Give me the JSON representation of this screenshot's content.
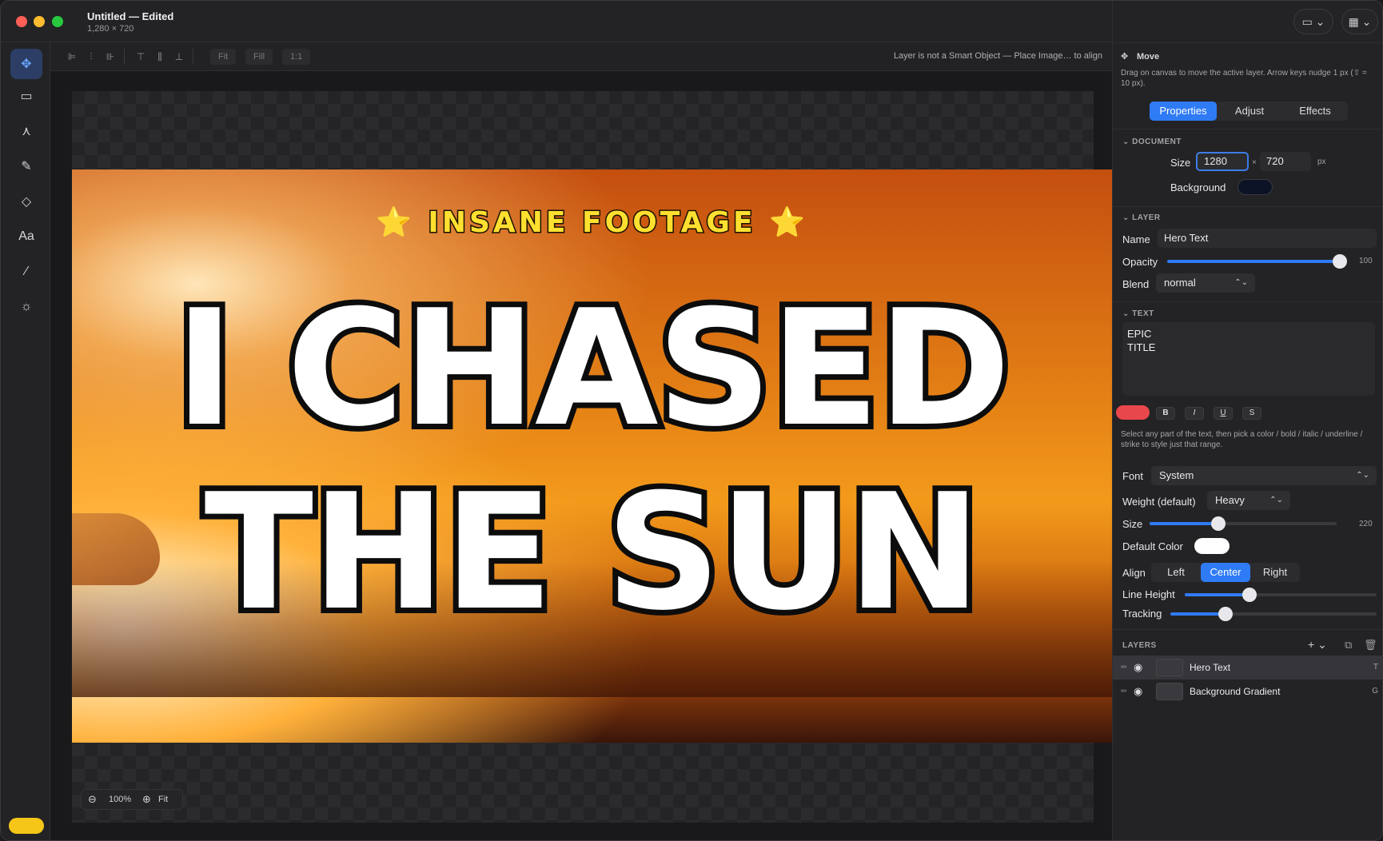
{
  "titlebar": {
    "title": "Untitled — Edited",
    "subtitle": "1,280 × 720"
  },
  "tools": [
    {
      "name": "move-tool",
      "icon": "move-icon",
      "glyph": "✥",
      "active": true
    },
    {
      "name": "marquee-tool",
      "icon": "marquee-icon",
      "glyph": "▭"
    },
    {
      "name": "pen-tool",
      "icon": "pen-icon",
      "glyph": "⋏"
    },
    {
      "name": "brush-tool",
      "icon": "brush-icon",
      "glyph": "✎"
    },
    {
      "name": "eraser-tool",
      "icon": "eraser-icon",
      "glyph": "◇"
    },
    {
      "name": "text-tool",
      "icon": "text-icon",
      "glyph": "Aa"
    },
    {
      "name": "eyedropper-tool",
      "icon": "eyedropper-icon",
      "glyph": "⁄"
    },
    {
      "name": "adjust-tool",
      "icon": "sun-icon",
      "glyph": "☼"
    }
  ],
  "optionsbar": {
    "fit": "Fit",
    "fill": "Fill",
    "one_to_one": "1:1",
    "hint": "Layer is not a Smart Object — Place Image… to align"
  },
  "canvas": {
    "subtitle": "⭐ INSANE FOOTAGE ⭐",
    "line1": "I CHASED",
    "line2": "THE SUN",
    "zoom": "100%",
    "zoom_fit": "Fit"
  },
  "panel": {
    "tool_name": "Move",
    "tool_desc": "Drag on canvas to move the active layer. Arrow keys nudge 1 px (⇧ = 10 px).",
    "tabs": [
      "Properties",
      "Adjust",
      "Effects"
    ],
    "document": {
      "header": "DOCUMENT",
      "size_label": "Size",
      "width": "1280",
      "times": "×",
      "height": "720",
      "unit": "px",
      "background_label": "Background",
      "background_color": "#0d1326"
    },
    "layer": {
      "header": "LAYER",
      "name_label": "Name",
      "name": "Hero Text",
      "opacity_label": "Opacity",
      "opacity": "100",
      "opacity_value": 100,
      "blend_label": "Blend",
      "blend": "normal"
    },
    "text": {
      "header": "TEXT",
      "content_1": "EPIC",
      "content_2": "TITLE",
      "color": "#e8474c",
      "bold": "B",
      "italic": "I",
      "underline": "U",
      "strike": "S",
      "help": "Select any part of the text, then pick a color / bold / italic / underline / strike to style just that range.",
      "font_label": "Font",
      "font": "System",
      "weight_label": "Weight (default)",
      "weight": "Heavy",
      "size_label": "Size",
      "size": "220",
      "size_value": 220,
      "default_color_label": "Default Color",
      "default_color": "#ffffff",
      "align_label": "Align",
      "align_options": [
        "Left",
        "Center",
        "Right"
      ],
      "align_selected": "Center",
      "line_height_label": "Line Height",
      "tracking_label": "Tracking"
    },
    "layers": {
      "header": "LAYERS",
      "items": [
        {
          "name": "Hero Text",
          "type": "T",
          "selected": true
        },
        {
          "name": "Background Gradient",
          "type": "G",
          "selected": false
        }
      ]
    }
  }
}
